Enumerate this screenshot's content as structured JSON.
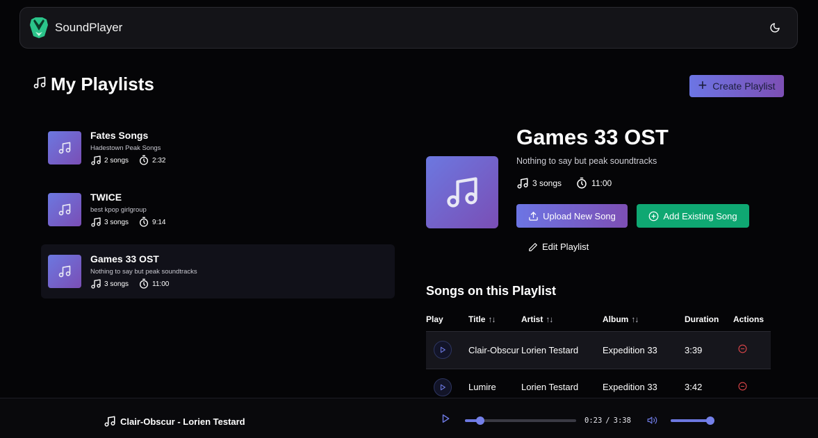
{
  "app": {
    "brand": "SoundPlayer"
  },
  "page": {
    "title": "My Playlists",
    "create_button": "Create Playlist"
  },
  "playlists": [
    {
      "name": "Fates Songs",
      "description": "Hadestown Peak Songs",
      "songs": "2 songs",
      "duration": "2:32"
    },
    {
      "name": "TWICE",
      "description": "best kpop girlgroup",
      "songs": "3 songs",
      "duration": "9:14"
    },
    {
      "name": "Games 33 OST",
      "description": "Nothing to say but peak soundtracks",
      "songs": "3 songs",
      "duration": "11:00"
    }
  ],
  "selected_playlist": {
    "title": "Games 33 OST",
    "description": "Nothing to say but peak soundtracks",
    "songs": "3 songs",
    "duration": "11:00",
    "upload_button": "Upload New Song",
    "add_existing_button": "Add Existing Song",
    "edit_button": "Edit Playlist"
  },
  "songs_section": {
    "heading": "Songs on this Playlist",
    "columns": {
      "play": "Play",
      "title": "Title",
      "artist": "Artist",
      "album": "Album",
      "duration": "Duration",
      "actions": "Actions"
    },
    "rows": [
      {
        "title": "Clair-Obscur",
        "artist": "Lorien Testard",
        "album": "Expedition 33",
        "duration": "3:39"
      },
      {
        "title": "Lumire",
        "artist": "Lorien Testard",
        "album": "Expedition 33",
        "duration": "3:42"
      }
    ]
  },
  "player": {
    "now_playing": "Clair-Obscur - Lorien Testard",
    "current_time": "0:23",
    "separator": "/",
    "total_time": "3:38",
    "progress_fraction": 0.14,
    "volume_fraction": 0.92
  },
  "colors": {
    "accent_start": "#6c75e4",
    "accent_end": "#7d4fb4",
    "success": "#0fa872",
    "danger": "#e0464a"
  }
}
